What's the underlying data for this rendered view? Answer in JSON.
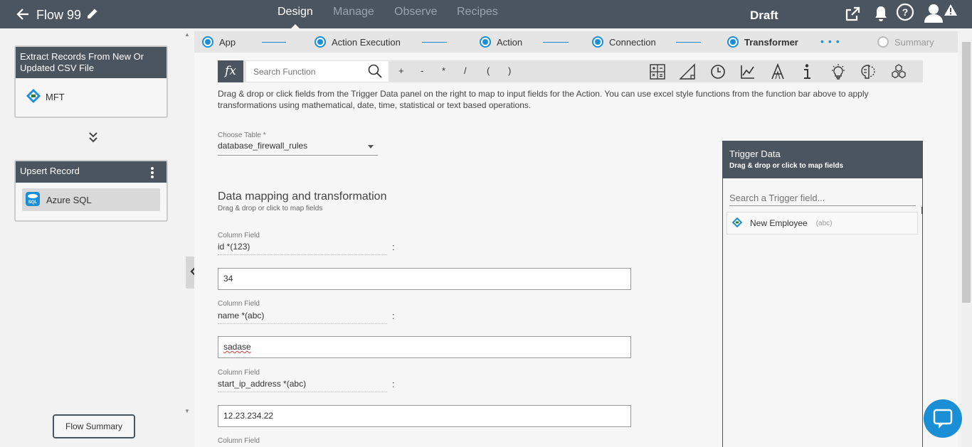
{
  "header": {
    "title": "Flow 99",
    "tabs": [
      "Design",
      "Manage",
      "Observe",
      "Recipes"
    ],
    "active_tab": "Design",
    "status": "Draft",
    "icons": [
      "back-arrow-icon",
      "pencil-icon",
      "external-link-icon",
      "bell-icon",
      "help-icon",
      "user-alert-icon"
    ]
  },
  "sidebar": {
    "trigger_card": {
      "title": "Extract Records From New Or Updated CSV File",
      "item": "MFT"
    },
    "action_card": {
      "title": "Upsert Record",
      "item": "Azure SQL"
    },
    "flow_summary_label": "Flow Summary"
  },
  "stepper": {
    "steps": [
      {
        "label": "App",
        "state": "done"
      },
      {
        "label": "Action Execution",
        "state": "done"
      },
      {
        "label": "Action",
        "state": "done"
      },
      {
        "label": "Connection",
        "state": "done"
      },
      {
        "label": "Transformer",
        "state": "current"
      },
      {
        "label": "Summary",
        "state": "pending"
      }
    ]
  },
  "function_bar": {
    "fx_label": "fx",
    "search_placeholder": "Search Function",
    "operators": [
      "+",
      "-",
      "*",
      "/",
      "(",
      ")"
    ],
    "tool_icons": [
      "calculator-icon",
      "geometry-icon",
      "clock-icon",
      "line-chart-icon",
      "text-icon",
      "info-icon",
      "lightbulb-icon",
      "brain-icon",
      "cubes-icon"
    ]
  },
  "instructions": "Drag & drop or click fields from the Trigger Data panel on the right to map to input fields for the Action. You can use excel style functions from the function bar above to apply transformations using mathematical, date, time, statistical or text based operations.",
  "table_select": {
    "label": "Choose Table *",
    "value": "database_firewall_rules"
  },
  "mapping": {
    "title": "Data mapping and transformation",
    "subtitle": "Drag & drop or click to map fields",
    "fields": [
      {
        "label": "Column Field",
        "name": "id *(123)",
        "value": "34"
      },
      {
        "label": "Column Field",
        "name": "name *(abc)",
        "value": "sadase"
      },
      {
        "label": "Column Field",
        "name": "start_ip_address *(abc)",
        "value": "12.23.234.22"
      },
      {
        "label": "Column Field"
      }
    ]
  },
  "trigger_panel": {
    "title": "Trigger Data",
    "subtitle": "Drag & drop or click to map fields",
    "search_placeholder": "Search a Trigger field...",
    "items": [
      {
        "name": "New Employee",
        "type": "(abc)"
      }
    ]
  },
  "colors": {
    "header_bg": "#4a5560",
    "accent": "#1a8fd6",
    "background": "#f2f2f2"
  }
}
